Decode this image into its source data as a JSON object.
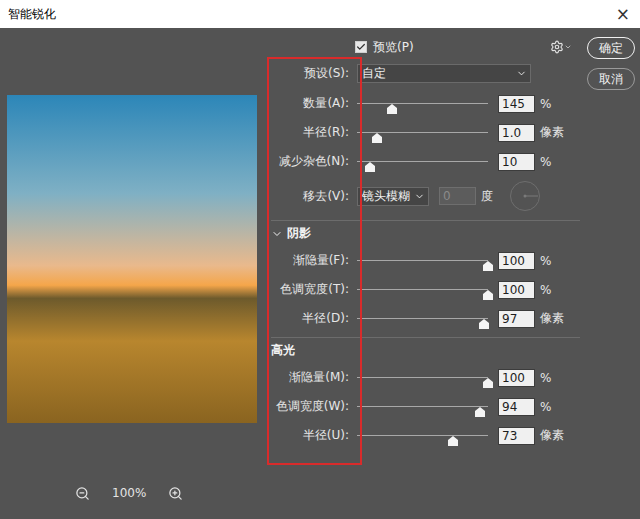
{
  "window": {
    "title": "智能锐化",
    "close": "×"
  },
  "preview": {
    "label": "预览(P)",
    "checked": true
  },
  "buttons": [
    {
      "label": "确定",
      "selected": true
    },
    {
      "label": "取消",
      "selected": false
    }
  ],
  "preset": {
    "label": "预设(S):",
    "value": "自定"
  },
  "sliders": [
    {
      "label": "数量(A):",
      "level": 0.27,
      "value": "145",
      "unit": "%"
    },
    {
      "label": "半径(R):",
      "level": 0.15,
      "value": "1.0",
      "unit": "像素"
    },
    {
      "label": "减少杂色(N):",
      "level": 0.1,
      "value": "10",
      "unit": "%"
    }
  ],
  "remove": {
    "label": "移去(V):",
    "value": "镜头模糊",
    "angle": "0",
    "angle_disabled": true,
    "unit": "度"
  },
  "sections": [
    {
      "title": "阴影",
      "kind": "toggle",
      "expanded": true,
      "sliders": [
        {
          "label": "渐隐量(F):",
          "level": 1,
          "value": "100",
          "unit": "%"
        },
        {
          "label": "色调宽度(T):",
          "level": 1,
          "value": "100",
          "unit": "%"
        },
        {
          "label": "半径(D):",
          "level": 0.97,
          "value": "97",
          "unit": "像素"
        }
      ]
    },
    {
      "title": "高光",
      "kind": "plain",
      "expanded": true,
      "sliders": [
        {
          "label": "渐隐量(M):",
          "level": 1,
          "value": "100",
          "unit": "%"
        },
        {
          "label": "色调宽度(W):",
          "level": 0.94,
          "value": "94",
          "unit": "%"
        },
        {
          "label": "半径(U):",
          "level": 0.73,
          "value": "73",
          "unit": "像素"
        }
      ]
    }
  ],
  "zoom": {
    "value": "100%"
  },
  "annotation": {
    "shown": true
  }
}
